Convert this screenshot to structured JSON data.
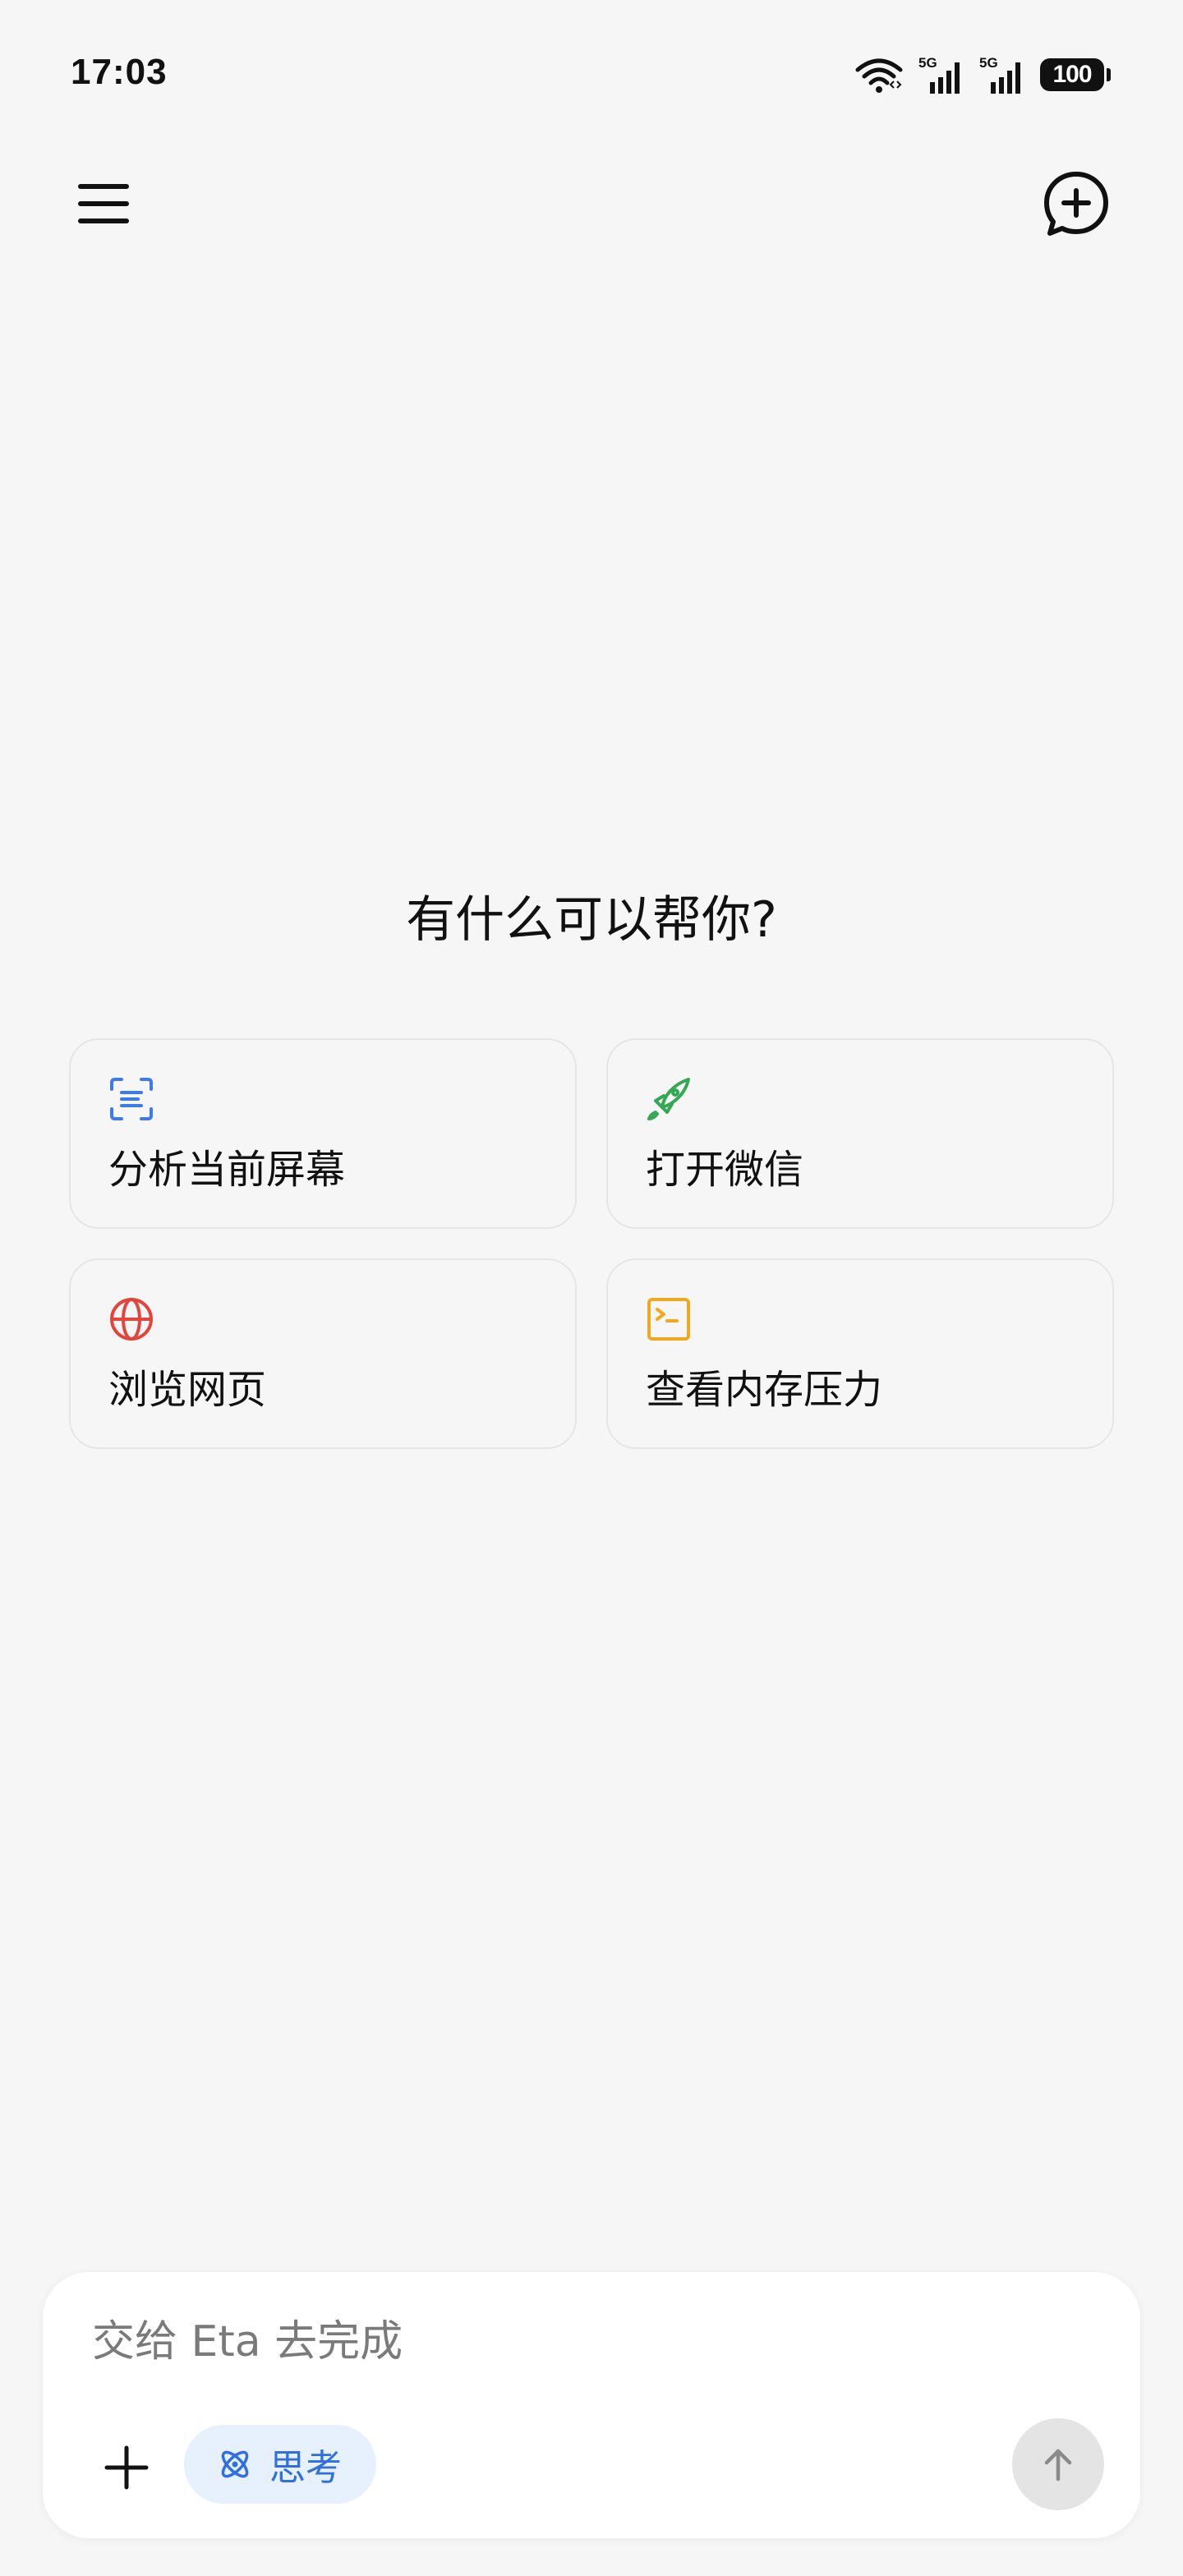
{
  "status_bar": {
    "time": "17:03",
    "signal_labels": [
      "5G",
      "5G"
    ],
    "battery": "100",
    "icons": [
      "wifi-icon",
      "signal-5g-icon",
      "signal-5g-icon",
      "battery-icon"
    ]
  },
  "header": {
    "menu_icon": "hamburger-menu-icon",
    "new_chat_icon": "new-chat-plus-icon"
  },
  "main": {
    "greeting": "有什么可以帮你?",
    "suggestions": [
      {
        "label": "分析当前屏幕",
        "icon": "scan-text-icon",
        "color": "#3b7ce6"
      },
      {
        "label": "打开微信",
        "icon": "rocket-icon",
        "color": "#34a853"
      },
      {
        "label": "浏览网页",
        "icon": "globe-icon",
        "color": "#e2453c"
      },
      {
        "label": "查看内存压力",
        "icon": "terminal-icon",
        "color": "#f0a81c"
      }
    ]
  },
  "composer": {
    "placeholder": "交给 Eta 去完成",
    "value": "",
    "think_label": "思考",
    "think_color": "#2f6fe0",
    "add_icon": "plus-icon",
    "think_icon": "atom-icon",
    "send_icon": "arrow-up-icon"
  }
}
